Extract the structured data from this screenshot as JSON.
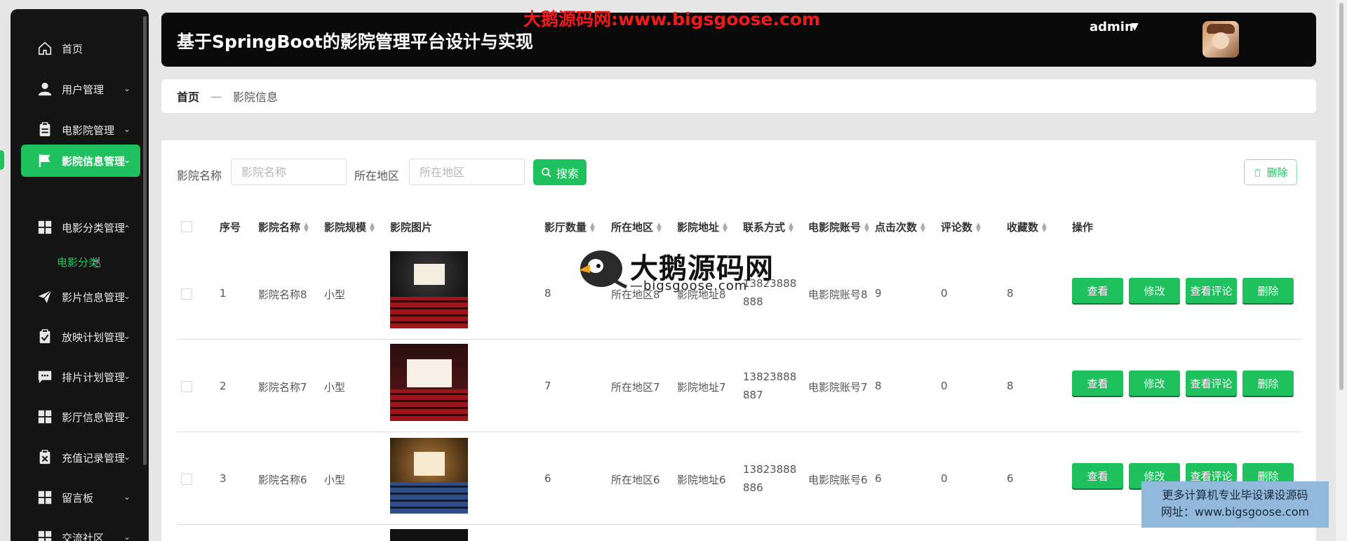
{
  "watermark": {
    "top": "大鹅源码网:www.bigsgoose.com",
    "logo_text": "大鹅源码网",
    "logo_sub": "—bigsgoose.com",
    "promo_line1": "更多计算机专业毕设课设源码",
    "promo_line2": "网址：www.bigsgoose.com"
  },
  "header": {
    "title": "基于SpringBoot的影院管理平台设计与实现",
    "user": "admin"
  },
  "sidebar": {
    "items": [
      {
        "label": "首页",
        "icon": "home-icon"
      },
      {
        "label": "用户管理",
        "icon": "user-icon"
      },
      {
        "label": "电影院管理",
        "icon": "clipboard-icon"
      },
      {
        "label": "影院信息管理",
        "icon": "flag-icon"
      },
      {
        "label": "电影分类管理",
        "icon": "grid-icon"
      },
      {
        "label": "影片信息管理",
        "icon": "send-icon"
      },
      {
        "label": "放映计划管理",
        "icon": "check-clipboard-icon"
      },
      {
        "label": "排片计划管理",
        "icon": "message-icon"
      },
      {
        "label": "影厅信息管理",
        "icon": "grid-icon"
      },
      {
        "label": "充值记录管理",
        "icon": "clipboard-x-icon"
      },
      {
        "label": "留言板",
        "icon": "grid-icon"
      },
      {
        "label": "交流社区",
        "icon": "grid-icon"
      }
    ],
    "submenu_label": "电影分类"
  },
  "breadcrumb": {
    "home": "首页",
    "separator": "—",
    "current": "影院信息"
  },
  "search": {
    "name_label": "影院名称",
    "name_placeholder": "影院名称",
    "region_label": "所在地区",
    "region_placeholder": "所在地区",
    "search_button": "搜索",
    "delete_button": "删除"
  },
  "table": {
    "columns": [
      "序号",
      "影院名称",
      "影院规模",
      "影院图片",
      "影厅数量",
      "所在地区",
      "影院地址",
      "联系方式",
      "电影院账号",
      "点击次数",
      "评论数",
      "收藏数",
      "操作"
    ],
    "rows": [
      {
        "idx": "1",
        "name": "影院名称8",
        "scale": "小型",
        "halls": "8",
        "region": "所在地区8",
        "address": "影院地址8",
        "phone": "13823888888",
        "account": "电影院账号8",
        "clicks": "9",
        "comments": "0",
        "favorites": "8"
      },
      {
        "idx": "2",
        "name": "影院名称7",
        "scale": "小型",
        "halls": "7",
        "region": "所在地区7",
        "address": "影院地址7",
        "phone": "13823888887",
        "account": "电影院账号7",
        "clicks": "8",
        "comments": "0",
        "favorites": "8"
      },
      {
        "idx": "3",
        "name": "影院名称6",
        "scale": "小型",
        "halls": "6",
        "region": "所在地区6",
        "address": "影院地址6",
        "phone": "13823888886",
        "account": "电影院账号6",
        "clicks": "6",
        "comments": "0",
        "favorites": "6"
      }
    ],
    "actions": {
      "view": "查看",
      "edit": "修改",
      "view_comments": "查看评论",
      "delete": "删除"
    }
  },
  "colors": {
    "accent": "#1fc15e",
    "header_bg": "#0a0a0a",
    "sidebar_bg": "#141414"
  }
}
